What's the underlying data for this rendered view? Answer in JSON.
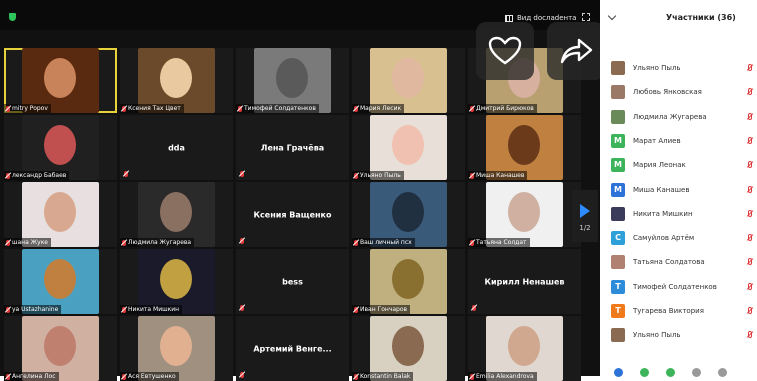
{
  "toolbar": {
    "view_label": "Вид docлadента",
    "icons": {
      "security": "shield-icon",
      "view": "grid-icon",
      "fullscreen": "fullscreen-icon"
    }
  },
  "overlay": {
    "like": "heart-icon",
    "share": "share-arrow-icon",
    "favorite": "star-icon",
    "add": "plus-icon"
  },
  "tiles": [
    {
      "label": "mitry Popov",
      "active": true
    },
    {
      "label": "Ксения Тах Цвет"
    },
    {
      "label": "Тимофей Солдатенков"
    },
    {
      "label": "Мария Лесик"
    },
    {
      "label": "Дмитрий Бирюков"
    },
    {
      "label": "лександр Бабаев"
    },
    {
      "name": "dda"
    },
    {
      "name": "Лена Грачёва"
    },
    {
      "label": "Ульяно Пыль"
    },
    {
      "label": "Миша Канашев"
    },
    {
      "label": "шана Жуке"
    },
    {
      "label": "Людмила Жугарева"
    },
    {
      "name": "Ксения Ващенко"
    },
    {
      "label": "Ваш личный псх"
    },
    {
      "label": "Татьяна Солдат"
    },
    {
      "label": "ya Ustazhanine"
    },
    {
      "label": "Никита Мишкин"
    },
    {
      "name": "bess"
    },
    {
      "label": "Иван Гончаров"
    },
    {
      "name": "Кирилл Ненашев"
    },
    {
      "label": "Ангелина Лос"
    },
    {
      "label": "Ася Евтушенко"
    },
    {
      "name": "Артемий Венге..."
    },
    {
      "label": "Konstantin Balak"
    },
    {
      "label": "Emilia Alexandrova"
    }
  ],
  "pager": {
    "count": "1/2"
  },
  "participants": {
    "title": "Участники (36)",
    "items": [
      {
        "name": "Ульяно Пыль",
        "avatar": "",
        "color": "#8a6a50"
      },
      {
        "name": "Любовь Янковская",
        "avatar": "",
        "color": "#9a7a66"
      },
      {
        "name": "Людмила Жугарева",
        "avatar": "",
        "color": "#6a8a5a"
      },
      {
        "name": "Марат Алиев",
        "avatar": "M",
        "color": "#3db45a"
      },
      {
        "name": "Мария Леонак",
        "avatar": "M",
        "color": "#3db45a"
      },
      {
        "name": "Миша Канашев",
        "avatar": "M",
        "color": "#2d72d9"
      },
      {
        "name": "Никита Мишкин",
        "avatar": "",
        "color": "#3a3a5a"
      },
      {
        "name": "Самуйлов Артём",
        "avatar": "C",
        "color": "#2da0d9"
      },
      {
        "name": "Татьяна Солдатова",
        "avatar": "",
        "color": "#b08070"
      },
      {
        "name": "Тимофей Солдатенков",
        "avatar": "T",
        "color": "#2d8cd9"
      },
      {
        "name": "Тугарева Виктория",
        "avatar": "T",
        "color": "#f07a1a"
      },
      {
        "name": "Ульяно Пыль",
        "avatar": "",
        "color": "#8a6a50"
      }
    ]
  }
}
